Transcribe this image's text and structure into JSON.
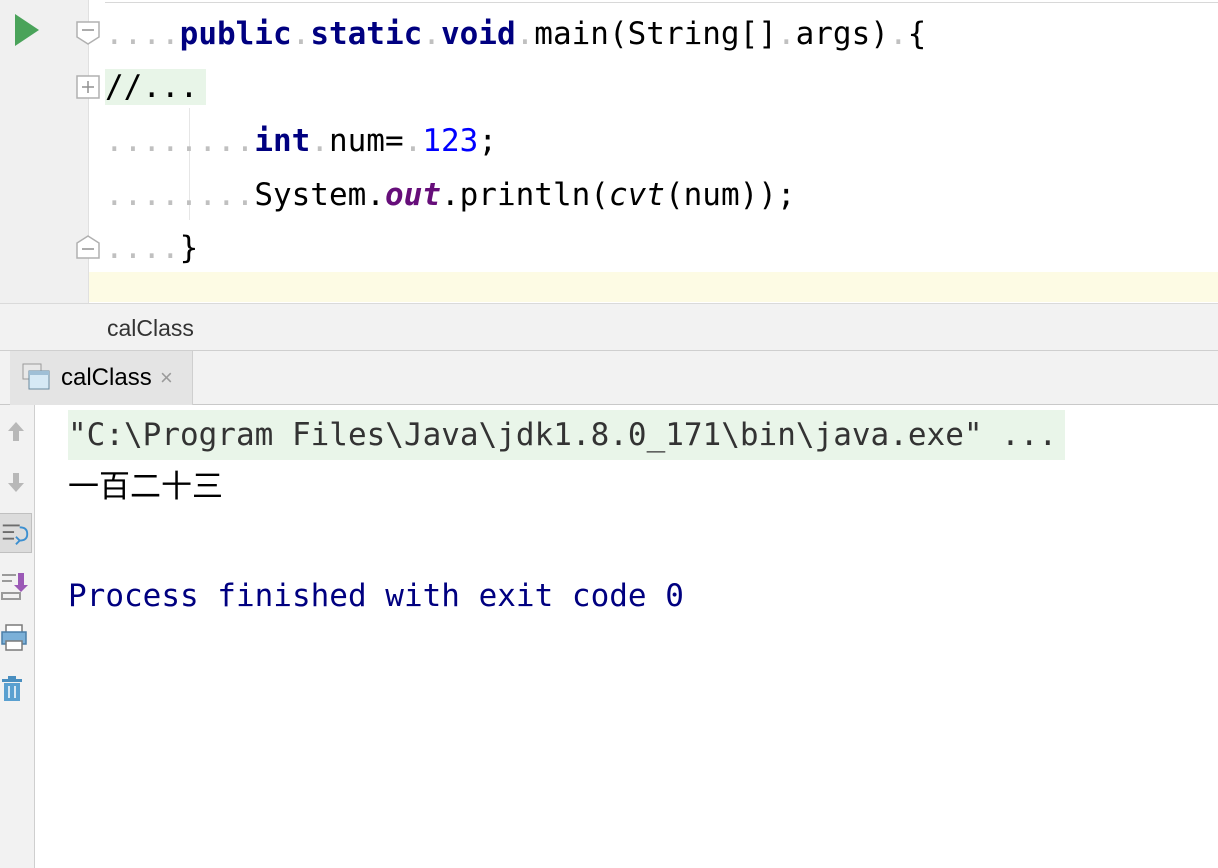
{
  "editor": {
    "lines": [
      {
        "indent": "....",
        "kw1": "public",
        "kw2": "static",
        "kw3": "void",
        "rest": "main(String[]",
        "args": "args)",
        "brace": "{"
      },
      {
        "fold_text": "//..."
      },
      {
        "indent": "........",
        "type": "int",
        "name": "num=",
        "value": "123",
        "end": ";"
      },
      {
        "indent": "........",
        "obj": "System.",
        "field": "out",
        "dot": ".println(",
        "call": "cvt",
        "tail": "(num));"
      },
      {
        "indent": "....",
        "brace": "}"
      }
    ]
  },
  "breadcrumb": {
    "label": "calClass"
  },
  "run_window": {
    "tab": {
      "label": "calClass",
      "close": "×"
    },
    "toolbar": [
      "up-arrow-icon",
      "down-arrow-icon",
      "soft-wrap-icon",
      "scroll-to-end-icon",
      "print-icon",
      "trash-icon"
    ],
    "console": {
      "command": "\"C:\\Program Files\\Java\\jdk1.8.0_171\\bin\\java.exe\" ...",
      "output": "一百二十三",
      "exit": "Process finished with exit code 0"
    }
  },
  "colors": {
    "run_green": "#4aa35a",
    "keyword": "#000080",
    "number": "#0000ff",
    "field": "#660e7a",
    "current_line": "#fdfbe4"
  }
}
